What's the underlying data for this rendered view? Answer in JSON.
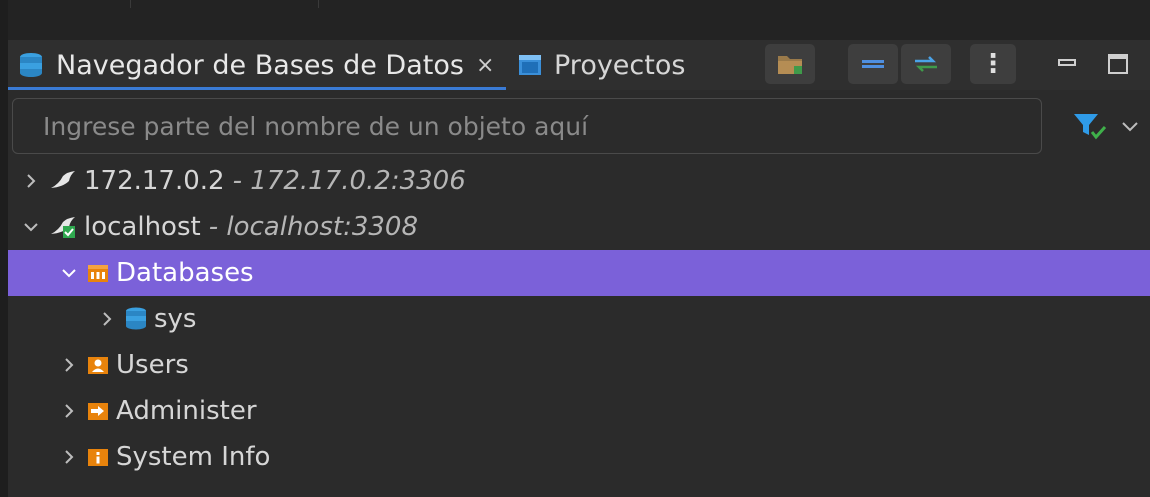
{
  "tabs": [
    {
      "label": "Navegador de Bases de Datos",
      "active": true,
      "close": "×"
    },
    {
      "label": "Proyectos",
      "active": false
    }
  ],
  "toolbar": {
    "more": "⋮"
  },
  "search": {
    "placeholder": "Ingrese parte del nombre de un objeto aquí",
    "value": ""
  },
  "tree": [
    {
      "name": "172.17.0.2",
      "detail": "- 172.17.0.2:3306",
      "expanded": false,
      "level": 0,
      "icon": "mysql-connection-icon"
    },
    {
      "name": "localhost",
      "detail": "- localhost:3308",
      "expanded": true,
      "level": 0,
      "icon": "mysql-connected-icon"
    },
    {
      "name": "Databases",
      "expanded": true,
      "level": 1,
      "icon": "databases-folder-icon",
      "selected": true
    },
    {
      "name": "sys",
      "expanded": false,
      "level": 2,
      "icon": "database-icon"
    },
    {
      "name": "Users",
      "expanded": false,
      "level": 1,
      "icon": "users-folder-icon"
    },
    {
      "name": "Administer",
      "expanded": false,
      "level": 1,
      "icon": "administer-folder-icon"
    },
    {
      "name": "System Info",
      "expanded": false,
      "level": 1,
      "icon": "system-info-folder-icon"
    }
  ],
  "colors": {
    "selection": "#7b61d9",
    "accent": "#3a7bd5",
    "folder": "#e8830c"
  }
}
